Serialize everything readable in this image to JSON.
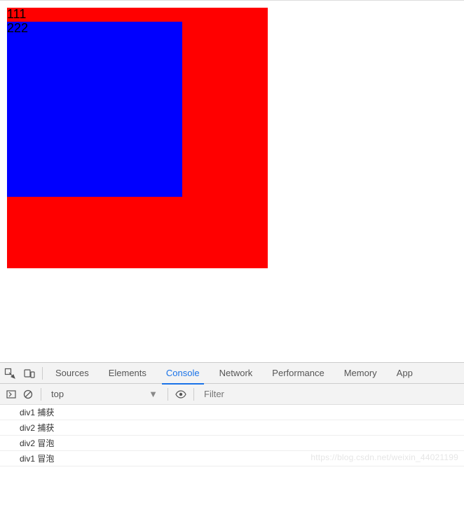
{
  "viewport": {
    "outer_text": "111",
    "inner_text": "222"
  },
  "devtools": {
    "tabs": {
      "sources": "Sources",
      "elements": "Elements",
      "console": "Console",
      "network": "Network",
      "performance": "Performance",
      "memory": "Memory",
      "application": "App"
    },
    "active_tab": "console",
    "toolbar": {
      "context": "top",
      "filter_placeholder": "Filter"
    },
    "logs": [
      "div1 捕获",
      "div2 捕获",
      "div2 冒泡",
      "div1 冒泡"
    ]
  },
  "watermark": "https://blog.csdn.net/weixin_44021199"
}
